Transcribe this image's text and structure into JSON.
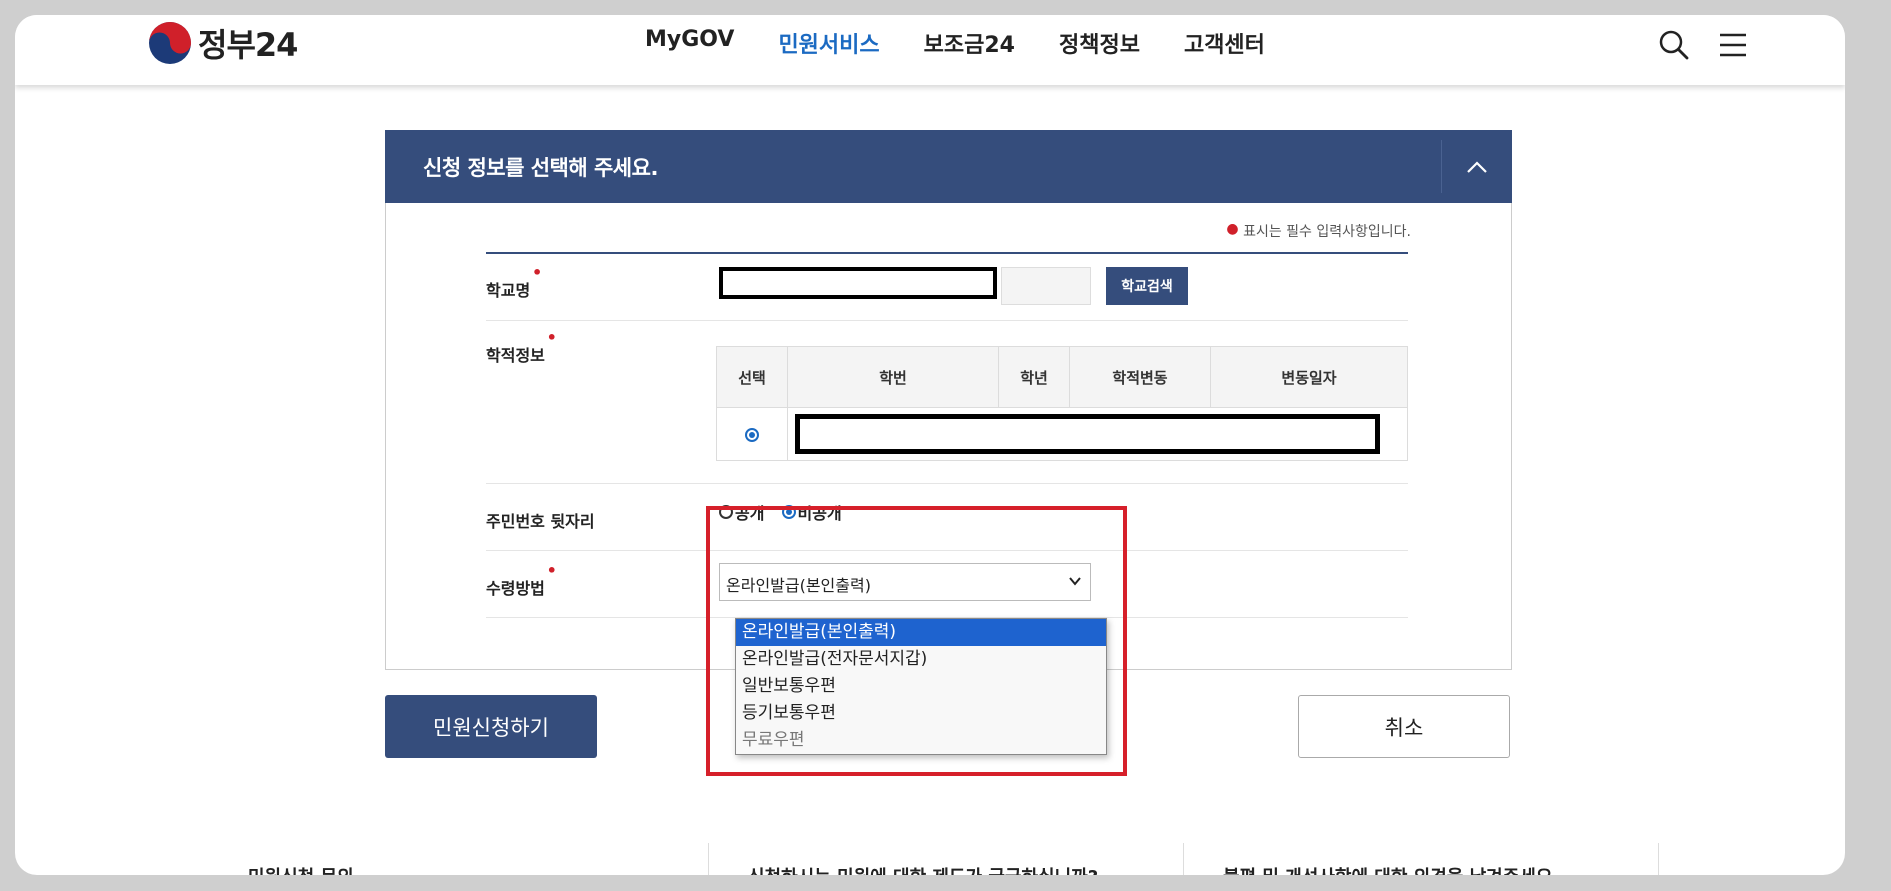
{
  "header": {
    "logo_text": "정부24",
    "nav": [
      "MyGOV",
      "민원서비스",
      "보조금24",
      "정책정보",
      "고객센터"
    ],
    "active_nav_index": 1,
    "accent_color": "#1b6ac2"
  },
  "panel": {
    "title": "신청 정보를 선택해 주세요.",
    "required_note": "표시는 필수 입력사항입니다.",
    "header_color": "#354d7c"
  },
  "fields": {
    "school_label": "학교명",
    "school_search_button": "학교검색",
    "record_label": "학적정보",
    "record_columns": [
      "선택",
      "학번",
      "학년",
      "학적변동",
      "변동일자"
    ],
    "rrn_label": "주민번호 뒷자리",
    "rrn_options": [
      "공개",
      "비공개"
    ],
    "rrn_selected": "비공개",
    "receive_label": "수령방법",
    "receive_selected": "온라인발급(본인출력)",
    "receive_options": [
      "온라인발급(본인출력)",
      "온라인발급(전자문서지갑)",
      "일반보통우편",
      "등기보통우편",
      "무료우편"
    ]
  },
  "buttons": {
    "apply": "민원신청하기",
    "cancel": "취소"
  },
  "footer": {
    "col1": "민원신청 문의",
    "col2": "신청하시는 민원에 대한 제도가 궁금하십니까?",
    "col3": "불편 및 개선사항에 대한 의견을 남겨주세요."
  },
  "icons": [
    "logo-icon",
    "search-icon",
    "menu-icon",
    "chevron-up-icon",
    "chevron-down-icon"
  ]
}
